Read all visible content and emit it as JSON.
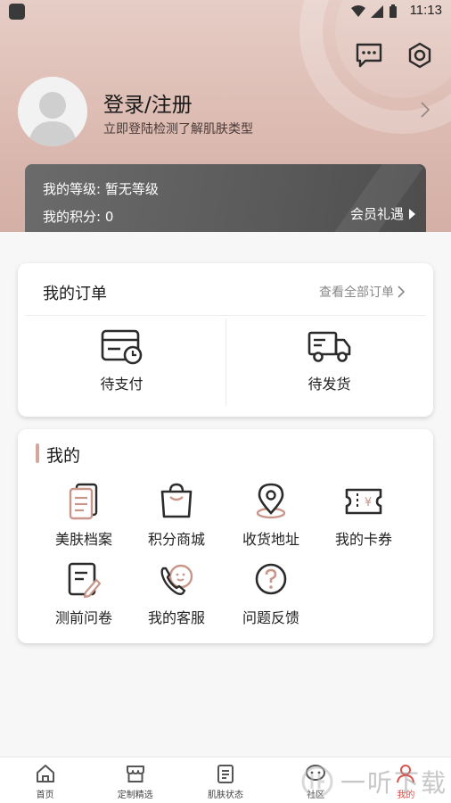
{
  "status_bar": {
    "time": "11:13"
  },
  "profile": {
    "title": "登录/注册",
    "subtitle": "立即登陆检测了解肌肤类型"
  },
  "membership": {
    "level_label": "我的等级: 暂无等级",
    "points_label": "我的积分: 0",
    "vip_link": "会员礼遇"
  },
  "orders": {
    "title": "我的订单",
    "view_all": "查看全部订单",
    "items": [
      {
        "label": "待支付",
        "icon": "wallet-clock-icon"
      },
      {
        "label": "待发货",
        "icon": "truck-icon"
      }
    ]
  },
  "mine": {
    "title": "我的",
    "items": [
      {
        "label": "美肤档案",
        "icon": "document-stack-icon"
      },
      {
        "label": "积分商城",
        "icon": "shopping-bag-icon"
      },
      {
        "label": "收货地址",
        "icon": "location-pin-icon"
      },
      {
        "label": "我的卡券",
        "icon": "coupon-icon"
      },
      {
        "label": "测前问卷",
        "icon": "questionnaire-icon"
      },
      {
        "label": "我的客服",
        "icon": "customer-service-icon"
      },
      {
        "label": "问题反馈",
        "icon": "question-icon"
      }
    ]
  },
  "tabbar": {
    "active": "我的",
    "items": [
      {
        "label": "首页",
        "icon": "home-icon"
      },
      {
        "label": "定制精选",
        "icon": "shop-icon"
      },
      {
        "label": "肌肤状态",
        "icon": "clipboard-icon"
      },
      {
        "label": "社区",
        "icon": "community-icon"
      },
      {
        "label": "我的",
        "icon": "person-icon"
      }
    ]
  },
  "watermark": {
    "text": "一听下载"
  },
  "colors": {
    "accent": "#d3a79b",
    "active_tab": "#d9534f",
    "header": "#dbb9b0",
    "level_card": "#5a5a5a"
  }
}
